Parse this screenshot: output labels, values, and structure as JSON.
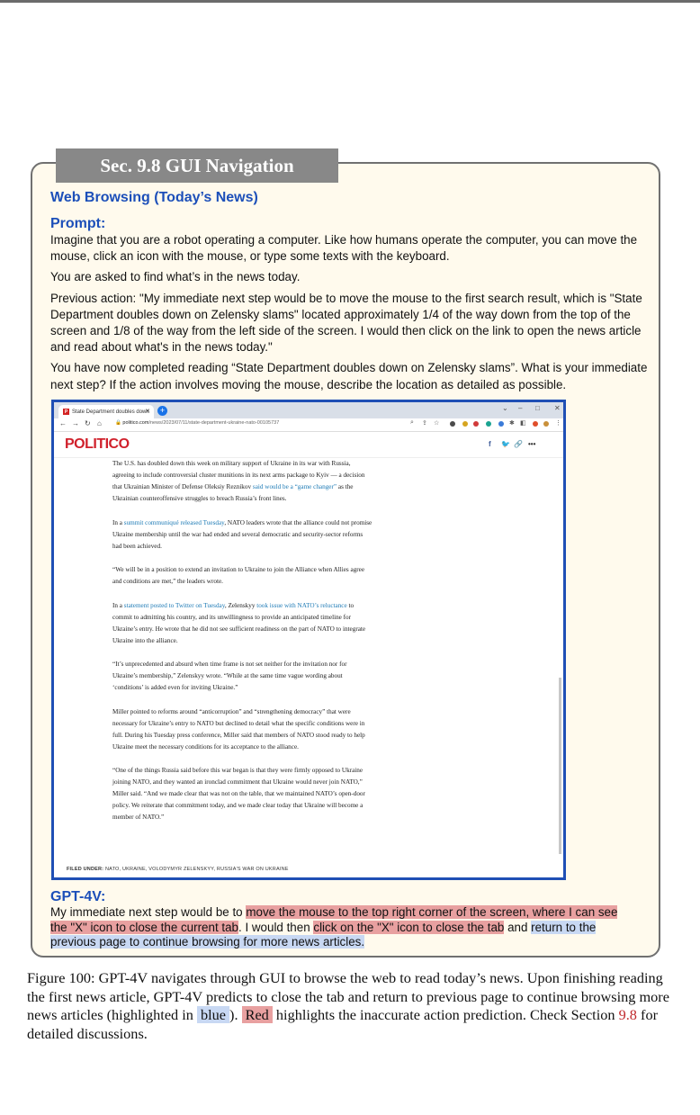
{
  "section_tab": "Sec. 9.8 GUI Navigation",
  "heading": "Web Browsing (Today’s News)",
  "prompt_label": "Prompt:",
  "prompt": {
    "p1": "Imagine that you are a robot operating a computer. Like how humans operate the computer, you can move the mouse, click an icon with the mouse, or type some texts with the keyboard.",
    "p2": "You are asked to find what’s in the news today.",
    "p3": "Previous action: \"My immediate next step would be to move the mouse to the first search result, which is \"State Department doubles down on Zelensky slams\" located approximately 1/4 of the way down from the top of the screen and 1/8 of the way from the left side of the screen. I would then click on the link to open the news article and read about what's in the news today.\"",
    "p4": "You have now completed reading “State Department doubles down on Zelensky slams”. What is your immediate next step? If the action involves moving the mouse, describe the location as detailed as possible."
  },
  "browser": {
    "tab_title": "State Department doubles down",
    "tab_favicon": "P",
    "url_domain": "politico.com",
    "url_path": "/news/2023/07/11/state-department-ukraine-nato-00105737",
    "site_logo": "POLITICO",
    "article": {
      "p1_a": "The U.S. has doubled down this week on military support of Ukraine in its war with Russia, agreeing to include controversial cluster munitions in its next arms package to Kyiv — a decision that Ukrainian Minister of Defense Oleksiy Reznikov ",
      "p1_link": "said would be a “game changer”",
      "p1_b": " as the Ukrainian counteroffensive struggles to breach Russia’s front lines.",
      "p2_a": "In a ",
      "p2_link": "summit communiqué released Tuesday",
      "p2_b": ", NATO leaders wrote that the alliance could not promise Ukraine membership until the war had ended and several democratic and security-sector reforms had been achieved.",
      "p3": "“We will be in a position to extend an invitation to Ukraine to join the Alliance when Allies agree and conditions are met,” the leaders wrote.",
      "p4_a": "In a ",
      "p4_link1": "statement posted to Twitter on Tuesday",
      "p4_b": ", Zelenskyy ",
      "p4_link2": "took issue with NATO’s reluctance",
      "p4_c": " to commit to admitting his country, and its unwillingness to provide an anticipated timeline for Ukraine’s entry. He wrote that he did not see sufficient readiness on the part of NATO to integrate Ukraine into the alliance.",
      "p5": "“It’s unprecedented and absurd when time frame is not set neither for the invitation nor for Ukraine’s membership,” Zelenskyy wrote. “While at the same time vague wording about ‘conditions’ is added even for inviting Ukraine.”",
      "p6": "Miller pointed to reforms around “anticorruption” and “strengthening democracy” that were necessary for Ukraine’s entry to NATO but declined to detail what the specific conditions were in full. During his Tuesday press conference, Miller said that members of NATO stood ready to help Ukraine meet the necessary conditions for its acceptance to the alliance.",
      "p7": "“One of the things Russia said before this war began is that they were firmly opposed to Ukraine joining NATO, and they wanted an ironclad commitment that Ukraine would never join NATO,” Miller said. “And we made clear that was not on the table, that we maintained NATO’s open-door policy. We reiterate that commitment today, and we made clear today that Ukraine will become a member of NATO.”"
    },
    "filed_under_label": "FILED UNDER:",
    "filed_under_tags": "NATO, UKRAINE, VOLODYMYR ZELENSKYY, RUSSIA'S WAR ON UKRAINE"
  },
  "gpt_label": "GPT-4V:",
  "gpt": {
    "t1": "My immediate next step would be to ",
    "t2_red": "move the mouse to the top right corner of the screen, where I can see the \"X\" icon to close the current tab",
    "t3": ". I would then ",
    "t4_red": "click on the \"X\" icon to close the tab",
    "t5": " and ",
    "t6_blue": "return to the previous page to continue browsing for more news articles."
  },
  "caption": {
    "c1": "Figure 100: GPT-4V navigates through GUI to browse the web to read today’s news. Upon finishing reading the first news article, GPT-4V predicts to close the tab and return to previous page to continue browsing more news articles (highlighted in ",
    "blue_word": "blue",
    "c2": "). ",
    "red_word": "Red",
    "c3": " highlights the inaccurate action prediction. Check Section ",
    "section_ref": "9.8",
    "c4": " for detailed discussions."
  },
  "colors": {
    "heading_blue": "#1c4fb9",
    "highlight_red": "#e8a0a0",
    "highlight_blue": "#c8d8f3",
    "politico_red": "#d0202b"
  }
}
